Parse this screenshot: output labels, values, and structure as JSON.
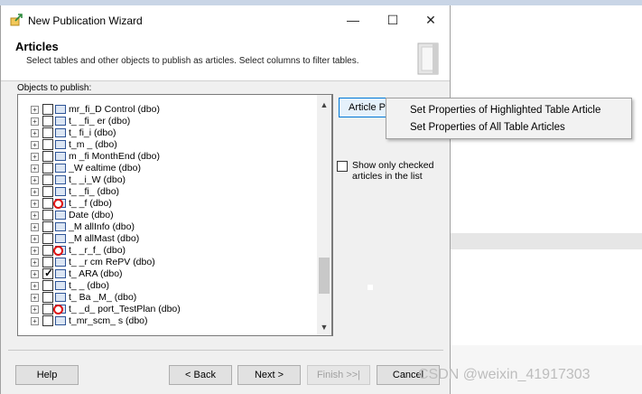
{
  "window": {
    "title": "New Publication Wizard",
    "controls": {
      "minimize": "—",
      "maximize": "☐",
      "close": "✕"
    }
  },
  "header": {
    "title": "Articles",
    "description": "Select tables and other objects to publish as articles. Select columns to filter tables."
  },
  "objects_label": "Objects to publish:",
  "tree_rows": [
    {
      "label": "mr_fi_D    Control (dbo)",
      "checked": false,
      "blocked": false
    },
    {
      "label": "t_   _fi_        er (dbo)",
      "checked": false,
      "blocked": false
    },
    {
      "label": "t_   fi_i   (dbo)",
      "checked": false,
      "blocked": false
    },
    {
      "label": "t_m        _       (dbo)",
      "checked": false,
      "blocked": false
    },
    {
      "label": "m   _fi          MonthEnd (dbo)",
      "checked": false,
      "blocked": false
    },
    {
      "label": "_W            ealtime (dbo)",
      "checked": false,
      "blocked": false
    },
    {
      "label": "t_   _i_W      (dbo)",
      "checked": false,
      "blocked": false
    },
    {
      "label": "t_   _fi_        (dbo)",
      "checked": false,
      "blocked": false
    },
    {
      "label": "t_   _f         (dbo)",
      "checked": false,
      "blocked": true
    },
    {
      "label": "                Date   (dbo)",
      "checked": false,
      "blocked": false
    },
    {
      "label": "        _M       allInfo  (dbo)",
      "checked": false,
      "blocked": false
    },
    {
      "label": "           _M       allMast   (dbo)",
      "checked": false,
      "blocked": false
    },
    {
      "label": "t_   _r_f_     (dbo)",
      "checked": false,
      "blocked": true
    },
    {
      "label": "t_   _r   cm     RePV   (dbo)",
      "checked": false,
      "blocked": false
    },
    {
      "label": "t_           ARA  (dbo)",
      "checked": true,
      "blocked": false
    },
    {
      "label": "t_              _   (dbo)",
      "checked": false,
      "blocked": false
    },
    {
      "label": "t_        Ba    _M_     (dbo)",
      "checked": false,
      "blocked": false
    },
    {
      "label": "t_   _d_              port_TestPlan (dbo)",
      "checked": false,
      "blocked": true
    },
    {
      "label": "t_mr_scm_  s      (dbo)",
      "checked": false,
      "blocked": false
    }
  ],
  "article_properties_button": "Article Pr",
  "show_only_checked": {
    "label": "Show only checked articles in the list",
    "checked": false
  },
  "context_menu": {
    "items": [
      "Set Properties of Highlighted Table Article",
      "Set Properties of All Table Articles"
    ]
  },
  "buttons": {
    "help": "Help",
    "back": "< Back",
    "next": "Next >",
    "finish": "Finish >>|",
    "cancel": "Cancel"
  },
  "watermark": "CSDN @weixin_41917303",
  "colors": {
    "accent_button_border": "#0078d7",
    "window_bg": "#f0f0f0",
    "blocked_icon": "#dd1111"
  }
}
